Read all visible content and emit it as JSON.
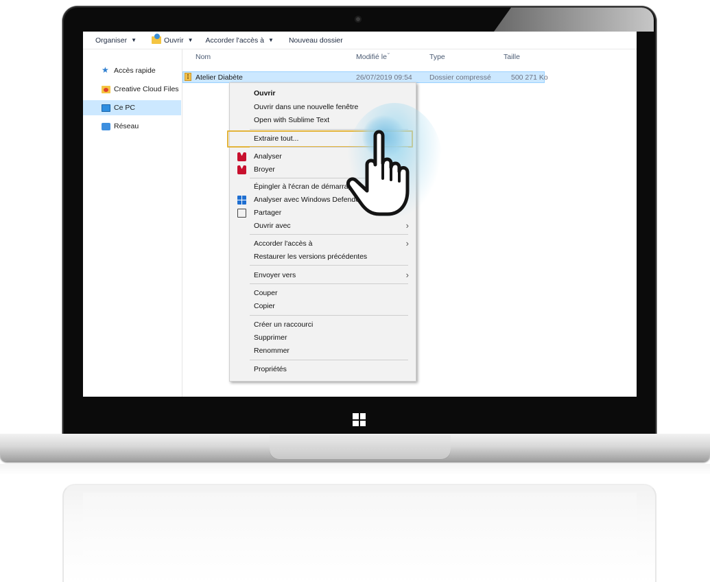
{
  "toolbar": {
    "organize": "Organiser",
    "open": "Ouvrir",
    "share_access": "Accorder l'accès à",
    "new_folder": "Nouveau dossier"
  },
  "nav": {
    "items": [
      {
        "label": "Accès rapide",
        "icon": "pin-icon"
      },
      {
        "label": "Creative Cloud Files",
        "icon": "creative-cloud-folder-icon"
      },
      {
        "label": "Ce PC",
        "icon": "computer-icon",
        "selected": true
      },
      {
        "label": "Réseau",
        "icon": "network-icon"
      }
    ]
  },
  "columns": {
    "name": "Nom",
    "modified": "Modifié le",
    "type": "Type",
    "size": "Taille"
  },
  "file": {
    "name": "Atelier Diabète",
    "modified": "26/07/2019 09:54",
    "type": "Dossier compressé",
    "size": "500 271 Ko",
    "icon": "zip-folder-icon"
  },
  "menu": {
    "items": [
      {
        "label": "Ouvrir",
        "bold": true
      },
      {
        "label": "Ouvrir dans une nouvelle fenêtre"
      },
      {
        "label": "Open with Sublime Text"
      },
      {
        "label": "Extraire tout...",
        "highlighted": true
      },
      {
        "label": "Analyser",
        "icon": "mcafee-icon"
      },
      {
        "label": "Broyer",
        "icon": "mcafee-icon"
      },
      {
        "label": "Épingler à l'écran de démarrage"
      },
      {
        "label": "Analyser avec Windows Defender...",
        "icon": "windows-defender-icon"
      },
      {
        "label": "Partager",
        "icon": "share-icon"
      },
      {
        "label": "Ouvrir avec",
        "submenu": true
      },
      {
        "label": "Accorder l'accès à",
        "submenu": true
      },
      {
        "label": "Restaurer les versions précédentes"
      },
      {
        "label": "Envoyer vers",
        "submenu": true
      },
      {
        "label": "Couper"
      },
      {
        "label": "Copier"
      },
      {
        "label": "Créer un raccourci"
      },
      {
        "label": "Supprimer"
      },
      {
        "label": "Renommer"
      },
      {
        "label": "Propriétés"
      }
    ]
  },
  "colors": {
    "selection": "#cce8ff",
    "highlight_border": "#e3b43a",
    "mcafee": "#c8102e",
    "defender": "#1f6fd1"
  }
}
